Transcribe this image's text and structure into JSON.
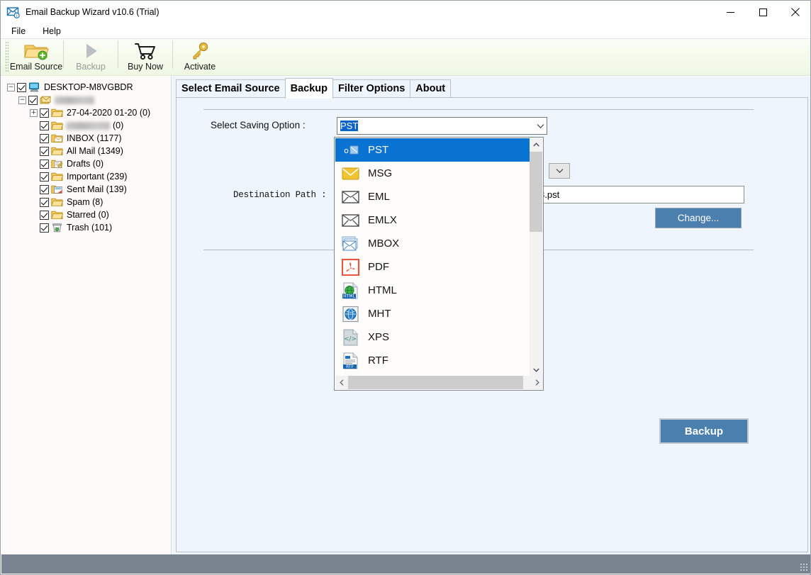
{
  "window": {
    "title": "Email Backup Wizard v10.6 (Trial)",
    "icon": "envelope-badge-icon",
    "minimize": "minimize-icon",
    "maximize": "maximize-icon",
    "close": "close-icon"
  },
  "menubar": {
    "items": [
      {
        "label": "File"
      },
      {
        "label": "Help"
      }
    ]
  },
  "toolbar": {
    "buttons": [
      {
        "label": "Email Source",
        "icon": "folder-add-icon",
        "disabled": false
      },
      {
        "label": "Backup",
        "icon": "play-triangle-icon",
        "disabled": true
      },
      {
        "label": "Buy Now",
        "icon": "shopping-cart-icon",
        "disabled": false
      },
      {
        "label": "Activate",
        "icon": "key-icon",
        "disabled": false
      }
    ]
  },
  "tree": {
    "root": {
      "label": "DESKTOP-M8VGBDR",
      "icon": "computer-icon",
      "checked": true,
      "expanded": true
    },
    "account": {
      "label": "",
      "redacted": true,
      "redacted_width": 56,
      "icon": "mail-stack-icon",
      "checked": true,
      "expanded": true
    },
    "folders": [
      {
        "label": "27-04-2020 01-20 (0)",
        "icon": "folder-icon",
        "checked": true,
        "expandable": true,
        "redacted": false
      },
      {
        "label": "(0)",
        "icon": "folder-icon",
        "checked": true,
        "expandable": false,
        "redacted": true,
        "redacted_width": 62
      },
      {
        "label": "INBOX (1177)",
        "icon": "inbox-folder-icon",
        "checked": true,
        "expandable": false,
        "redacted": false
      },
      {
        "label": "All Mail (1349)",
        "icon": "folder-icon",
        "checked": true,
        "expandable": false,
        "redacted": false
      },
      {
        "label": "Drafts (0)",
        "icon": "drafts-folder-icon",
        "checked": true,
        "expandable": false,
        "redacted": false
      },
      {
        "label": "Important (239)",
        "icon": "folder-icon",
        "checked": true,
        "expandable": false,
        "redacted": false
      },
      {
        "label": "Sent Mail (139)",
        "icon": "sent-folder-icon",
        "checked": true,
        "expandable": false,
        "redacted": false
      },
      {
        "label": "Spam (8)",
        "icon": "folder-icon",
        "checked": true,
        "expandable": false,
        "redacted": false
      },
      {
        "label": "Starred (0)",
        "icon": "folder-icon",
        "checked": true,
        "expandable": false,
        "redacted": false
      },
      {
        "label": "Trash (101)",
        "icon": "trash-folder-icon",
        "checked": true,
        "expandable": false,
        "redacted": false
      }
    ]
  },
  "tabs": [
    {
      "label": "Select Email Source",
      "active": false
    },
    {
      "label": "Backup",
      "active": true
    },
    {
      "label": "Filter Options",
      "active": false
    },
    {
      "label": "About",
      "active": false
    }
  ],
  "backup_panel": {
    "saving_option_label": "Select Saving Option :",
    "saving_option_value": "PST",
    "destination_path_label": "Destination Path :",
    "destination_path_value": "3.pst",
    "change_button": "Change...",
    "backup_button": "Backup",
    "dropdown_arrow_icon": "chevron-down-icon"
  },
  "saving_option_dropdown": {
    "open": true,
    "selected_index": 0,
    "scroll_up_icon": "chevron-up-icon",
    "scroll_down_icon": "chevron-down-icon",
    "hscroll_left_icon": "chevron-left-icon",
    "hscroll_right_icon": "chevron-right-icon",
    "items": [
      {
        "label": "PST",
        "icon": "outlook-pst-icon",
        "selected": true
      },
      {
        "label": "MSG",
        "icon": "msg-envelope-icon",
        "selected": false
      },
      {
        "label": "EML",
        "icon": "eml-envelope-icon",
        "selected": false
      },
      {
        "label": "EMLX",
        "icon": "emlx-envelope-icon",
        "selected": false
      },
      {
        "label": "MBOX",
        "icon": "mbox-stack-icon",
        "selected": false
      },
      {
        "label": "PDF",
        "icon": "pdf-file-icon",
        "selected": false
      },
      {
        "label": "HTML",
        "icon": "html-file-icon",
        "selected": false
      },
      {
        "label": "MHT",
        "icon": "mht-globe-icon",
        "selected": false
      },
      {
        "label": "XPS",
        "icon": "xps-file-icon",
        "selected": false
      },
      {
        "label": "RTF",
        "icon": "rtf-file-icon",
        "selected": false
      }
    ]
  },
  "statusbar": {
    "text": "",
    "grip_icon": "resize-grip-icon"
  },
  "colors": {
    "accent_blue": "#0a73d2",
    "button_blue": "#4a7fae",
    "toolbar_green": "#f3faea",
    "panel_blue": "#eef5fc",
    "statusbar_gray": "#78838f"
  }
}
